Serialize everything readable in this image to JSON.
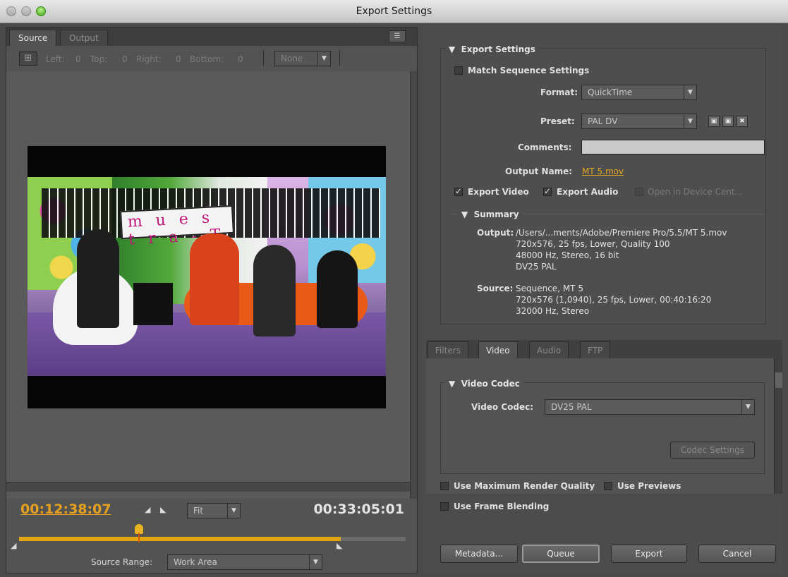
{
  "window": {
    "title": "Export Settings"
  },
  "left": {
    "tabs": [
      "Source",
      "Output"
    ],
    "crop": {
      "left_label": "Left:",
      "left": "0",
      "top_label": "Top:",
      "top": "0",
      "right_label": "Right:",
      "right": "0",
      "bottom_label": "Bottom:",
      "bottom": "0",
      "aspect": "None"
    },
    "current_time": "00:12:38:07",
    "duration": "00:33:05:01",
    "zoom": "Fit",
    "source_range_label": "Source Range:",
    "source_range": "Work Area",
    "playhead_fraction": 0.38
  },
  "export": {
    "heading": "Export Settings",
    "match_sequence": "Match Sequence Settings",
    "format_label": "Format:",
    "format": "QuickTime",
    "preset_label": "Preset:",
    "preset": "PAL DV",
    "comments_label": "Comments:",
    "output_name_label": "Output Name:",
    "output_name": "MT 5.mov",
    "export_video": "Export Video",
    "export_audio": "Export Audio",
    "open_device": "Open in Device Cent...",
    "summary_heading": "Summary",
    "output_label": "Output:",
    "output_lines": "/Users/...ments/Adobe/Premiere Pro/5.5/MT 5.mov\n720x576, 25 fps, Lower, Quality 100\n48000 Hz, Stereo, 16 bit\nDV25 PAL",
    "source_label": "Source:",
    "source_lines": "Sequence, MT 5\n720x576 (1,0940), 25 fps, Lower, 00:40:16:20\n32000 Hz, Stereo"
  },
  "settings_tabs": [
    "Filters",
    "Video",
    "Audio",
    "FTP"
  ],
  "video": {
    "heading": "Video Codec",
    "codec_label": "Video Codec:",
    "codec": "DV25 PAL",
    "codec_settings": "Codec Settings"
  },
  "options": {
    "max_quality": "Use Maximum Render Quality",
    "use_previews": "Use Previews",
    "frame_blending": "Use Frame Blending"
  },
  "buttons": {
    "metadata": "Metadata...",
    "queue": "Queue",
    "export": "Export",
    "cancel": "Cancel"
  },
  "colors": {
    "accent": "#e4a520",
    "panel": "#4c4c4c"
  }
}
